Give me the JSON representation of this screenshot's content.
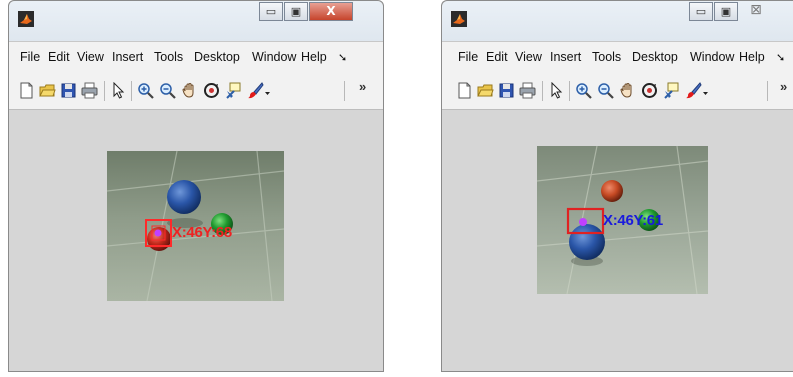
{
  "colors": {
    "window_bg": "#d6d6d6",
    "menubar_bg": "#f2f2f2",
    "close_button": "#c6442c",
    "red_label": "#ee2222",
    "blue_label": "#1a1add"
  },
  "windows": [
    {
      "app_icon": "matlab-figure-icon",
      "controls": {
        "minimize": "▭",
        "maximize": "▣",
        "close": "X"
      },
      "menu": [
        "File",
        "Edit",
        "View",
        "Insert",
        "Tools",
        "Desktop",
        "Window",
        "Help",
        "➘"
      ],
      "toolbar": [
        "new-figure-icon",
        "open-icon",
        "save-icon",
        "print-icon",
        "pointer-icon",
        "zoom-in-icon",
        "zoom-out-icon",
        "pan-hand-icon",
        "rotate-3d-icon",
        "data-cursor-icon",
        "brush-icon",
        "brush-dropdown-icon"
      ],
      "overflow": "»",
      "image": {
        "tracked_ball": "red",
        "balls": [
          "blue",
          "green",
          "red"
        ]
      },
      "tracking_label": "X:46Y:68"
    },
    {
      "app_icon": "matlab-figure-icon",
      "controls": {
        "minimize": "▭",
        "maximize": "▣",
        "close": "⊠"
      },
      "menu": [
        "File",
        "Edit",
        "View",
        "Insert",
        "Tools",
        "Desktop",
        "Window",
        "Help",
        "➘"
      ],
      "toolbar": [
        "new-figure-icon",
        "open-icon",
        "save-icon",
        "print-icon",
        "pointer-icon",
        "zoom-in-icon",
        "zoom-out-icon",
        "pan-hand-icon",
        "rotate-3d-icon",
        "data-cursor-icon",
        "brush-icon",
        "brush-dropdown-icon"
      ],
      "overflow": "»",
      "image": {
        "tracked_ball": "blue",
        "balls": [
          "red",
          "green",
          "blue"
        ]
      },
      "tracking_label": "X:46Y:61"
    }
  ]
}
